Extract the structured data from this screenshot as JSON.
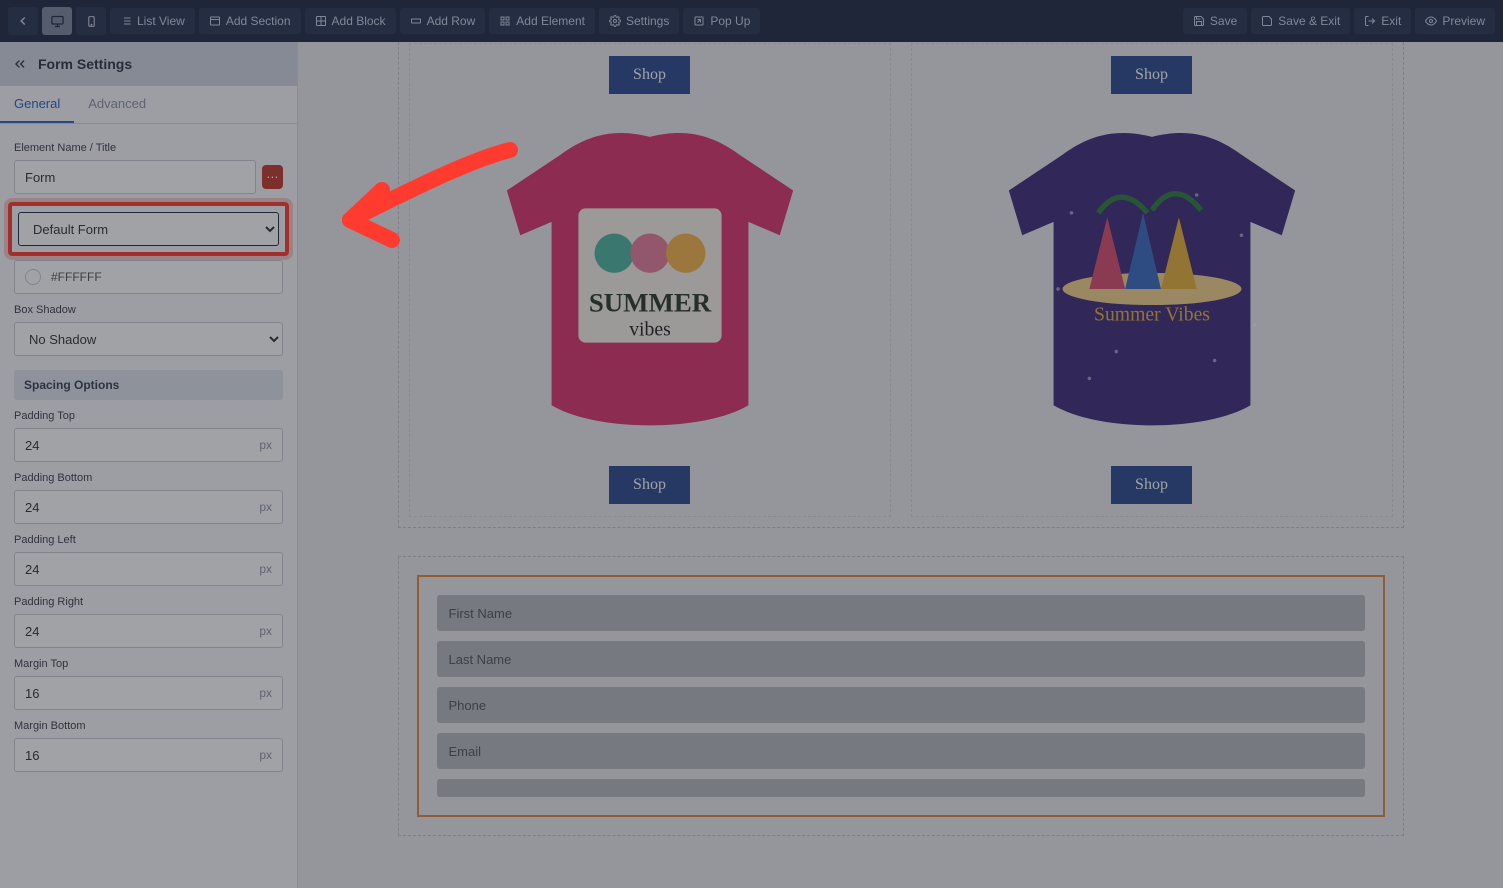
{
  "topbar": {
    "list_view": "List View",
    "add_section": "Add Section",
    "add_block": "Add Block",
    "add_row": "Add Row",
    "add_element": "Add Element",
    "settings": "Settings",
    "popup": "Pop Up",
    "save": "Save",
    "save_exit": "Save & Exit",
    "exit": "Exit",
    "preview": "Preview"
  },
  "panel": {
    "title": "Form Settings",
    "tab_general": "General",
    "tab_advanced": "Advanced",
    "element_name_label": "Element Name / Title",
    "element_name_value": "Form",
    "form_select_value": "Default Form",
    "bg_color_value": "#FFFFFF",
    "box_shadow_label": "Box Shadow",
    "box_shadow_value": "No Shadow",
    "spacing_heading": "Spacing Options",
    "padding_top_label": "Padding Top",
    "padding_top_value": "24",
    "padding_bottom_label": "Padding Bottom",
    "padding_bottom_value": "24",
    "padding_left_label": "Padding Left",
    "padding_left_value": "24",
    "padding_right_label": "Padding Right",
    "padding_right_value": "24",
    "margin_top_label": "Margin Top",
    "margin_top_value": "16",
    "margin_bottom_label": "Margin Bottom",
    "margin_bottom_value": "16",
    "unit": "px"
  },
  "canvas": {
    "shop_label": "Shop",
    "form_first_name": "First Name",
    "form_last_name": "Last Name",
    "form_phone": "Phone",
    "form_email": "Email"
  }
}
